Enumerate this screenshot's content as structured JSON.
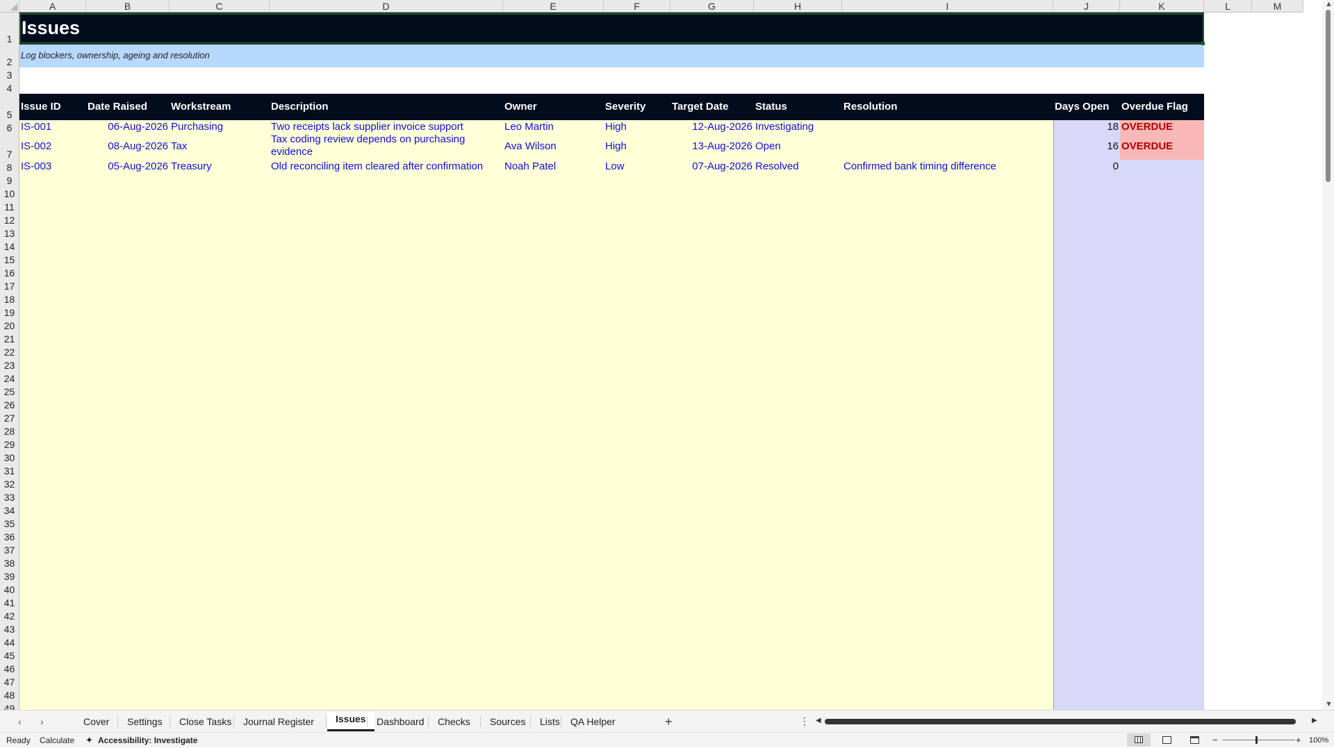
{
  "columns": [
    "A",
    "B",
    "C",
    "D",
    "E",
    "F",
    "G",
    "H",
    "I",
    "J",
    "K",
    "L",
    "M"
  ],
  "rows": [
    "1",
    "2",
    "3",
    "4",
    "5",
    "6",
    "7",
    "8",
    "9",
    "10",
    "11",
    "12",
    "13",
    "14",
    "15",
    "16",
    "17",
    "18",
    "19",
    "20",
    "21",
    "22",
    "23",
    "24",
    "25",
    "26",
    "27",
    "28",
    "29",
    "30",
    "31",
    "32",
    "33",
    "34",
    "35",
    "36",
    "37",
    "38",
    "39",
    "40",
    "41",
    "42",
    "43",
    "44",
    "45",
    "46",
    "47",
    "48",
    "49"
  ],
  "sheet": {
    "title": "Issues",
    "subtitle": "Log blockers, ownership, ageing and resolution",
    "headers": [
      "Issue ID",
      "Date Raised",
      "Workstream",
      "Description",
      "Owner",
      "Severity",
      "Target Date",
      "Status",
      "Resolution",
      "Days Open",
      "Overdue Flag"
    ],
    "issues": [
      {
        "id": "IS-001",
        "date_raised": "06-Aug-2026",
        "workstream": "Purchasing",
        "description": "Two receipts lack supplier invoice support",
        "owner": "Leo Martin",
        "severity": "High",
        "target_date": "12-Aug-2026",
        "status": "Investigating",
        "resolution": "",
        "days_open": "18",
        "overdue_flag": "OVERDUE"
      },
      {
        "id": "IS-002",
        "date_raised": "08-Aug-2026",
        "workstream": "Tax",
        "description": "Tax coding review depends on purchasing evidence",
        "owner": "Ava Wilson",
        "severity": "High",
        "target_date": "13-Aug-2026",
        "status": "Open",
        "resolution": "",
        "days_open": "16",
        "overdue_flag": "OVERDUE"
      },
      {
        "id": "IS-003",
        "date_raised": "05-Aug-2026",
        "workstream": "Treasury",
        "description": "Old reconciling item cleared after confirmation",
        "owner": "Noah Patel",
        "severity": "Low",
        "target_date": "07-Aug-2026",
        "status": "Resolved",
        "resolution": "Confirmed bank timing difference",
        "days_open": "0",
        "overdue_flag": ""
      }
    ]
  },
  "tabs": [
    "Cover",
    "Settings",
    "Close Tasks",
    "Journal Register",
    "Issues",
    "Dashboard",
    "Checks",
    "Sources",
    "Lists",
    "QA Helper"
  ],
  "active_tab": "Issues",
  "status_bar": {
    "ready": "Ready",
    "calculate": "Calculate",
    "accessibility": "Accessibility: Investigate",
    "zoom": "100%"
  },
  "colors": {
    "title_bg": "#020c1c",
    "header_bg": "#020c1c",
    "subtitle_bg": "#b7d8ff",
    "input_bg": "#ffffd8",
    "calc_bg": "#d8d8f8",
    "overdue_bg": "#f8b8b8",
    "value_text": "#1010d8"
  }
}
